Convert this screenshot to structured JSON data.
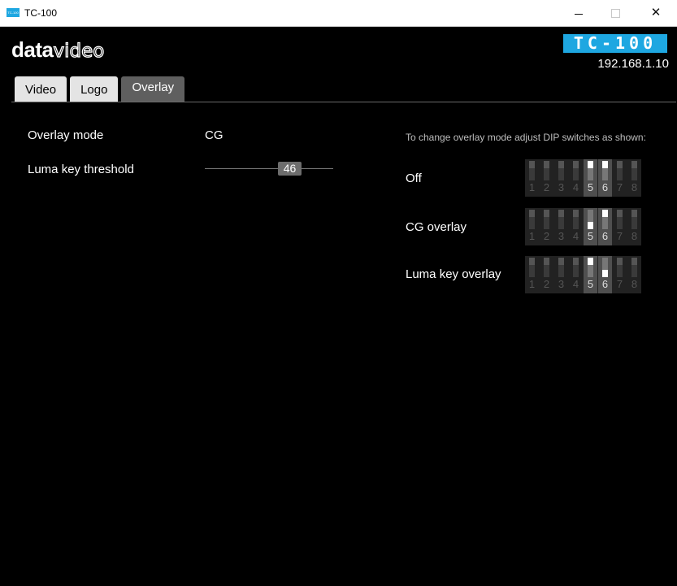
{
  "window": {
    "title": "TC-100",
    "icon_text": "TC-100",
    "controls": {
      "minimize": "minimize",
      "maximize": "maximize",
      "close": "✕"
    }
  },
  "header": {
    "logo_bold": "data",
    "logo_rest": "video",
    "model": "TC-100",
    "ip": "192.168.1.10"
  },
  "tabs": [
    {
      "label": "Video",
      "active": false
    },
    {
      "label": "Logo",
      "active": false
    },
    {
      "label": "Overlay",
      "active": true
    }
  ],
  "settings": {
    "overlay_mode_label": "Overlay mode",
    "overlay_mode_value": "CG",
    "luma_label": "Luma key threshold",
    "luma_value": "46"
  },
  "dip_panel": {
    "instruction": "To change overlay mode adjust DIP switches as shown:",
    "switch_numbers": [
      "1",
      "2",
      "3",
      "4",
      "5",
      "6",
      "7",
      "8"
    ],
    "options": [
      {
        "label": "Off",
        "switch5": "up",
        "switch6": "up"
      },
      {
        "label": "CG overlay",
        "switch5": "down",
        "switch6": "up"
      },
      {
        "label": "Luma key overlay",
        "switch5": "up",
        "switch6": "down"
      }
    ]
  },
  "colors": {
    "brand_blue": "#1ea7e1",
    "active_tab": "#5f5f5f",
    "inactive_tab": "#e4e4e4"
  }
}
